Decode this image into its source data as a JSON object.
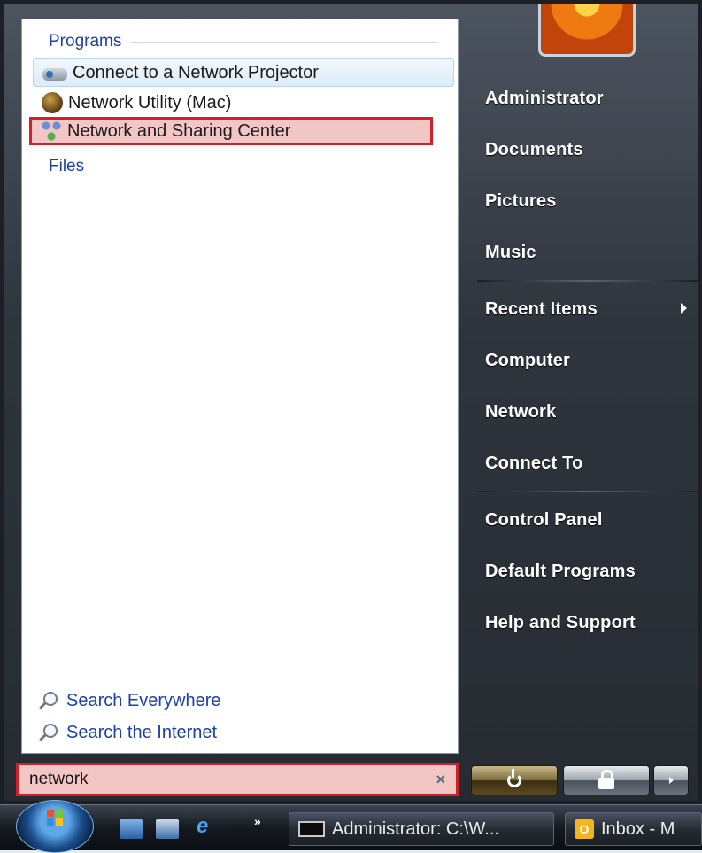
{
  "start_menu": {
    "left_panel": {
      "sections": {
        "programs_header": "Programs",
        "files_header": "Files"
      },
      "programs": [
        {
          "label": "Connect to a Network Projector",
          "icon": "projector-icon"
        },
        {
          "label": "Network Utility (Mac)",
          "icon": "network-utility-icon"
        },
        {
          "label": "Network and Sharing Center",
          "icon": "network-sharing-center-icon",
          "selected": true
        }
      ],
      "search_links": [
        {
          "label": "Search Everywhere",
          "icon": "search-icon"
        },
        {
          "label": "Search the Internet",
          "icon": "search-icon"
        }
      ],
      "search_box": {
        "value": "network",
        "clear_icon": "×"
      }
    },
    "right_panel": {
      "user_picture": "user-picture-flower",
      "items": [
        {
          "label": "Administrator"
        },
        {
          "label": "Documents"
        },
        {
          "label": "Pictures"
        },
        {
          "label": "Music"
        },
        {
          "label": "Recent Items",
          "has_submenu": true
        },
        {
          "label": "Computer"
        },
        {
          "label": "Network"
        },
        {
          "label": "Connect To"
        },
        {
          "label": "Control Panel"
        },
        {
          "label": "Default Programs"
        },
        {
          "label": "Help and Support"
        }
      ]
    }
  },
  "taskbar": {
    "quick_launch": [
      "show-desktop-icon",
      "switch-windows-icon",
      "internet-explorer-icon"
    ],
    "more": "»",
    "tasks": [
      {
        "label": "Administrator: C:\\W..."
      },
      {
        "label": "Inbox - M"
      }
    ]
  },
  "colors": {
    "selection_fill": "#f3c6c6",
    "selection_border": "#d0212a",
    "link_blue": "#1d3fa8"
  }
}
